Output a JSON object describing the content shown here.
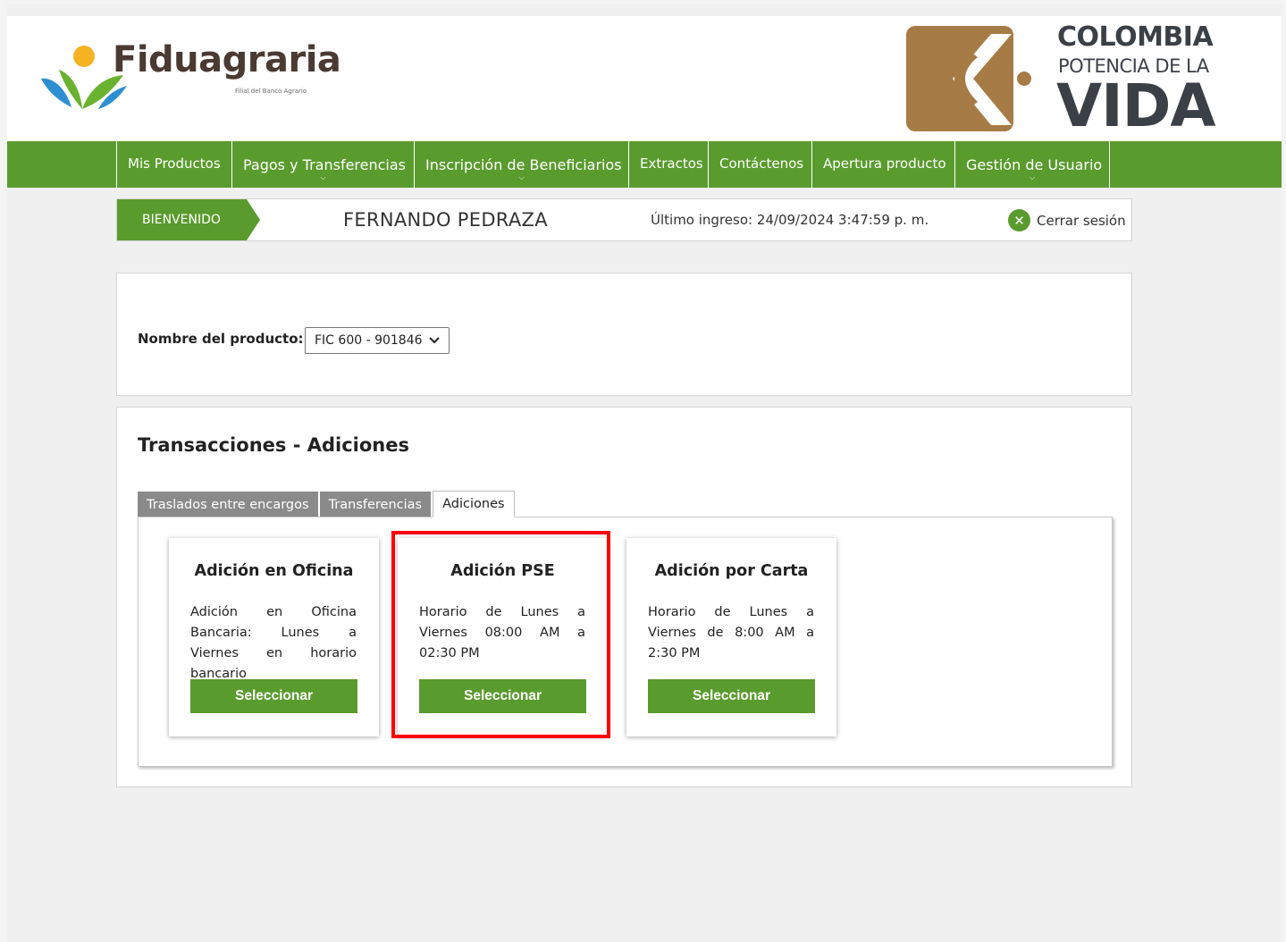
{
  "header": {
    "brand_name": "Fiduagraria",
    "brand_sub": "Filial del Banco Agrario",
    "gov_line1": "COLOMBIA",
    "gov_line2": "POTENCIA DE LA",
    "gov_line3": "VIDA"
  },
  "nav": {
    "items": [
      {
        "label": "Mis Productos",
        "has_dropdown": false
      },
      {
        "label": "Pagos y Transferencias",
        "has_dropdown": true
      },
      {
        "label": "Inscripción de Beneficiarios",
        "has_dropdown": true
      },
      {
        "label": "Extractos",
        "has_dropdown": false
      },
      {
        "label": "Contáctenos",
        "has_dropdown": false
      },
      {
        "label": "Apertura producto",
        "has_dropdown": false
      },
      {
        "label": "Gestión de Usuario",
        "has_dropdown": true
      }
    ]
  },
  "welcome": {
    "tag": "BIENVENIDO",
    "user_name": "FERNANDO PEDRAZA",
    "last_login": "Último ingreso: 24/09/2024 3:47:59 p. m.",
    "logout_label": "Cerrar sesión"
  },
  "product": {
    "label": "Nombre del producto:",
    "selected": "FIC 600 - 901846"
  },
  "transactions": {
    "title": "Transacciones - Adiciones",
    "tabs": [
      {
        "label": "Traslados entre encargos",
        "active": false
      },
      {
        "label": "Transferencias",
        "active": false
      },
      {
        "label": "Adiciones",
        "active": true
      }
    ],
    "cards": [
      {
        "title": "Adición en Oficina",
        "text": "Adición en Oficina Bancaria: Lunes a Viernes en horario bancario",
        "button": "Seleccionar"
      },
      {
        "title": "Adición PSE",
        "text": "Horario de Lunes a Viernes 08:00 AM a 02:30 PM",
        "button": "Seleccionar",
        "highlighted": true
      },
      {
        "title": "Adición por Carta",
        "text": "Horario de Lunes a Viernes de 8:00 AM a 2:30 PM",
        "button": "Seleccionar"
      }
    ]
  },
  "colors": {
    "brand_green": "#5a9b2e",
    "highlight_red": "#ff0000",
    "gold": "#a77b45"
  },
  "icons": {
    "brand": "fiduagraria-logo-icon",
    "gov": "colombia-logo-icon",
    "logout": "close-circle-icon",
    "select": "chevron-down-icon"
  }
}
